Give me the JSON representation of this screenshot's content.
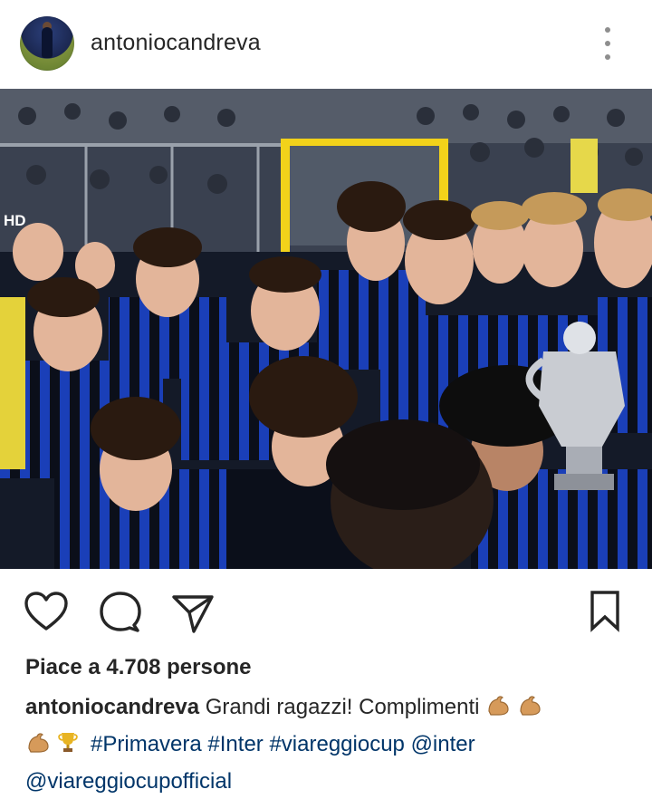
{
  "post": {
    "username": "antoniocandreva",
    "badge": "HD",
    "likes_text": "Piace a 4.708 persone",
    "caption": {
      "user": "antoniocandreva",
      "text": "Grandi ragazzi! Complimenti",
      "emoji_sequence": [
        "flexed-biceps",
        "flexed-biceps",
        "flexed-biceps",
        "trophy"
      ],
      "hashtags": [
        "#Primavera",
        "#Inter",
        "#viareggiocup"
      ],
      "mentions": [
        "@inter",
        "@viareggiocupofficial"
      ]
    }
  },
  "icons": {
    "more": "vertical-ellipsis-icon",
    "like": "heart-icon",
    "comment": "comment-bubble-icon",
    "share": "paper-plane-icon",
    "save": "bookmark-icon"
  },
  "colors": {
    "text": "#262626",
    "link": "#003569",
    "icon_gray": "#8e8e8e",
    "inter_blue": "#0a2a8c",
    "inter_black": "#0b0f1a"
  }
}
